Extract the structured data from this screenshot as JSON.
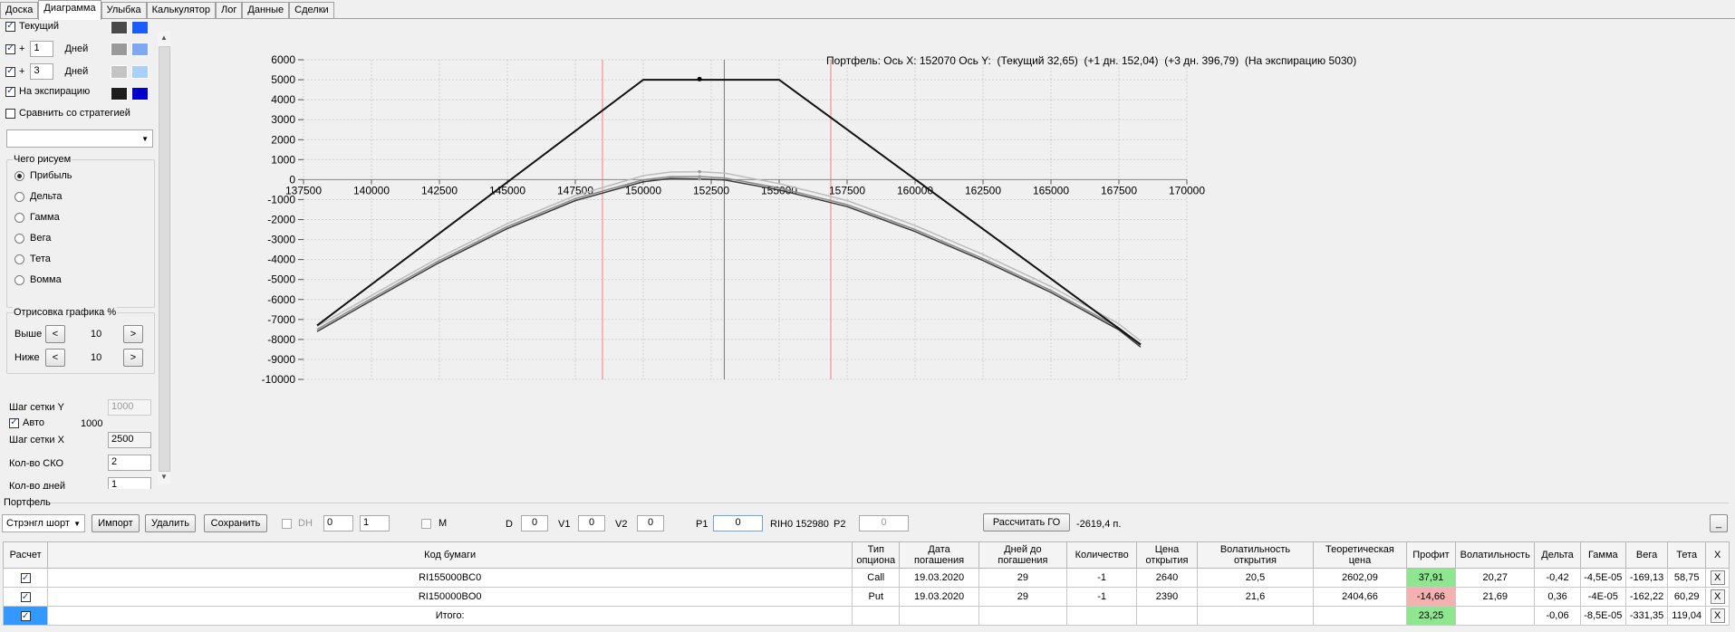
{
  "tabs": [
    "Доска",
    "Диаграмма",
    "Улыбка",
    "Калькулятор",
    "Лог",
    "Данные",
    "Сделки"
  ],
  "left": {
    "current_label": "Текущий",
    "days1_value": "1",
    "days_label": "Дней",
    "days3_value": "3",
    "plus": "+",
    "expiry_label": "На экспирацию",
    "compare_label": "Сравнить со стратегией",
    "what_title": "Чего рисуем",
    "radios": [
      "Прибыль",
      "Дельта",
      "Гамма",
      "Вега",
      "Тета",
      "Вомма"
    ],
    "draw_title": "Отрисовка графика %",
    "above_label": "Выше",
    "above_value": "10",
    "below_label": "Ниже",
    "below_value": "10",
    "lt": "<",
    "gt": ">",
    "grid_y_label": "Шаг сетки Y",
    "grid_y_value": "1000",
    "auto_label": "Авто",
    "auto_value": "1000",
    "grid_x_label": "Шаг сетки X",
    "grid_x_value": "2500",
    "sko_label": "Кол-во СКО",
    "sko_value": "2",
    "days_count_label": "Кол-во дней",
    "days_count_value": "1",
    "colors": {
      "cur_a": "#4a4a4a",
      "cur_b": "#1a5cff",
      "d1_a": "#9a9a9a",
      "d1_b": "#7ea8f0",
      "d3_a": "#c4c4c4",
      "d3_b": "#a8d0f8",
      "exp_a": "#1e1e1e",
      "exp_b": "#0000cc"
    }
  },
  "chart_title": "Портфель: Ось X: 152070 Ось Y:  (Текущий 32,65)  (+1 дн. 152,04)  (+3 дн. 396,79)  (На экспирацию 5030)",
  "chart_data": {
    "type": "line",
    "xlim": [
      137500,
      170000
    ],
    "ylim": [
      -10000,
      6000
    ],
    "x_ticks": [
      137500,
      140000,
      142500,
      145000,
      147500,
      150000,
      152500,
      155000,
      157500,
      160000,
      162500,
      165000,
      167500,
      170000
    ],
    "y_ticks": [
      6000,
      5000,
      4000,
      3000,
      2000,
      1000,
      0,
      -1000,
      -2000,
      -3000,
      -4000,
      -5000,
      -6000,
      -7000,
      -8000,
      -9000,
      -10000
    ],
    "cursor_x": 152980,
    "sigma_lines": [
      148500,
      156900
    ],
    "grid": true,
    "series": [
      {
        "name": "Текущий",
        "color": "#3a3a3a",
        "x": [
          138000,
          140000,
          142500,
          145000,
          147500,
          150000,
          151000,
          152070,
          153000,
          155000,
          157500,
          160000,
          162500,
          165000,
          167500,
          168300
        ],
        "y": [
          -7600,
          -6050,
          -4150,
          -2450,
          -1050,
          -110,
          60,
          33,
          -20,
          -520,
          -1350,
          -2600,
          -4050,
          -5650,
          -7520,
          -8380
        ]
      },
      {
        "name": "+1 дн.",
        "color": "#8a8a8a",
        "x": [
          138000,
          140000,
          142500,
          145000,
          147500,
          150000,
          151000,
          152070,
          153000,
          155000,
          157500,
          160000,
          162500,
          165000,
          167500,
          168300
        ],
        "y": [
          -7500,
          -5950,
          -4050,
          -2350,
          -950,
          -10,
          150,
          152,
          80,
          -420,
          -1250,
          -2500,
          -3950,
          -5550,
          -7420,
          -8280
        ]
      },
      {
        "name": "+3 дн.",
        "color": "#bcbcbc",
        "x": [
          138000,
          140000,
          142500,
          145000,
          147500,
          150000,
          151000,
          152070,
          153000,
          155000,
          157500,
          160000,
          162500,
          165000,
          167500,
          168300
        ],
        "y": [
          -7350,
          -5800,
          -3900,
          -2200,
          -800,
          200,
          380,
          397,
          320,
          -200,
          -1050,
          -2300,
          -3750,
          -5350,
          -7220,
          -8080
        ]
      },
      {
        "name": "На экспирацию",
        "color": "#111111",
        "x": [
          138000,
          150000,
          155000,
          168300
        ],
        "y": [
          -7300,
          5000,
          5000,
          -8250
        ]
      }
    ],
    "markers": [
      {
        "x": 152070,
        "y": 5030
      }
    ]
  },
  "bottom": {
    "section_label": "Портфель",
    "strategy": "Стрэнгл шорт",
    "import": "Импорт",
    "delete": "Удалить",
    "save": "Сохранить",
    "dh_label": "DH",
    "spin1": "0",
    "spin2": "1",
    "m_label": "M",
    "d_label": "D",
    "d_value": "0",
    "v1_label": "V1",
    "v1_value": "0",
    "v2_label": "V2",
    "v2_value": "0",
    "p1_label": "P1",
    "p1_value": "0",
    "rih": "RIH0 152980",
    "p2_label": "P2",
    "p2_value": "0",
    "calc_go": "Рассчитать ГО",
    "go_value": "-2619,4 п.",
    "minimize": "_"
  },
  "table": {
    "headers": [
      "Расчет",
      "Код бумаги",
      "Тип опциона",
      "Дата погашения",
      "Дней до погашения",
      "Количество",
      "Цена открытия",
      "Волатильность открытия",
      "Теоретическая цена",
      "Профит",
      "Волатильность",
      "Дельта",
      "Гамма",
      "Вега",
      "Тета",
      "X"
    ],
    "rows": [
      [
        "",
        "RI155000BC0",
        "Call",
        "19.03.2020",
        "29",
        "-1",
        "2640",
        "20,5",
        "2602,09",
        "37,91",
        "20,27",
        "-0,42",
        "-4,5E-05",
        "-169,13",
        "58,75",
        "X"
      ],
      [
        "",
        "RI150000BO0",
        "Put",
        "19.03.2020",
        "29",
        "-1",
        "2390",
        "21,6",
        "2404,66",
        "-14,66",
        "21,69",
        "0,36",
        "-4E-05",
        "-162,22",
        "60,29",
        "X"
      ],
      [
        "",
        "Итого:",
        "",
        "",
        "",
        "",
        "",
        "",
        "",
        "23,25",
        "",
        "-0,06",
        "-8,5E-05",
        "-331,35",
        "119,04",
        "X"
      ]
    ]
  }
}
